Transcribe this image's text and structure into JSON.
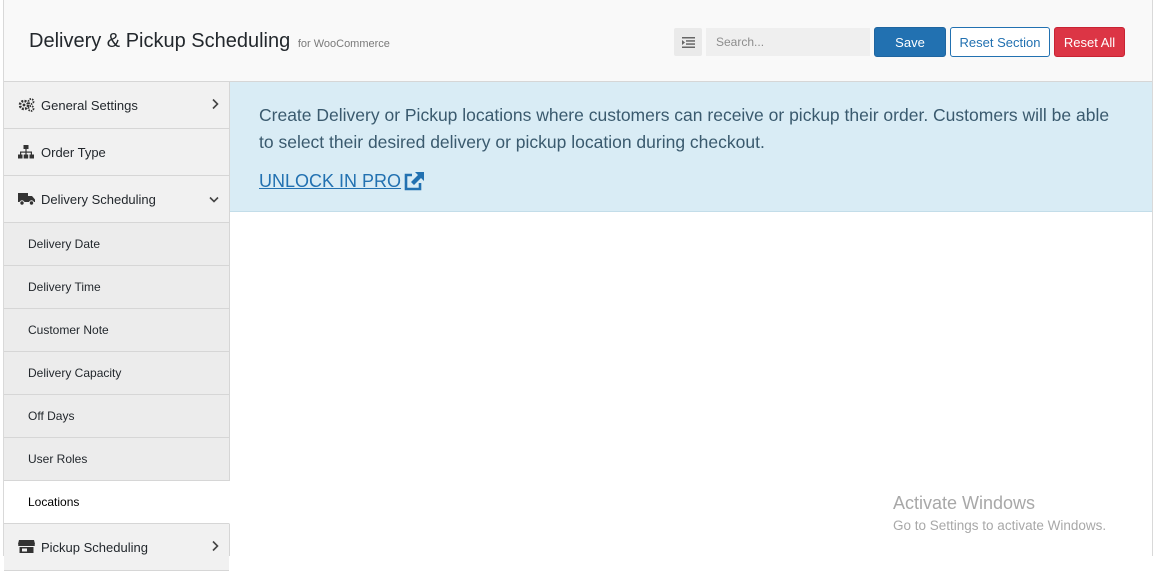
{
  "header": {
    "title": "Delivery & Pickup Scheduling",
    "subtitle": "for WooCommerce",
    "search_placeholder": "Search...",
    "save_label": "Save",
    "reset_section_label": "Reset Section",
    "reset_all_label": "Reset All"
  },
  "sidebar": {
    "items": [
      {
        "label": "General Settings",
        "icon": "cogs-icon"
      },
      {
        "label": "Order Type",
        "icon": "sitemap-icon"
      },
      {
        "label": "Delivery Scheduling",
        "icon": "truck-icon"
      }
    ],
    "sub_items": [
      {
        "label": "Delivery Date"
      },
      {
        "label": "Delivery Time"
      },
      {
        "label": "Customer Note"
      },
      {
        "label": "Delivery Capacity"
      },
      {
        "label": "Off Days"
      },
      {
        "label": "User Roles"
      },
      {
        "label": "Locations",
        "active": true
      }
    ],
    "after_items": [
      {
        "label": "Pickup Scheduling",
        "icon": "store-icon"
      }
    ]
  },
  "main": {
    "notice_text": "Create Delivery or Pickup locations where customers can receive or pickup their order. Customers will be able to select their desired delivery or pickup location during checkout.",
    "unlock_label": "UNLOCK IN PRO"
  },
  "watermark": {
    "title": "Activate Windows",
    "subtitle": "Go to Settings to activate Windows."
  },
  "colors": {
    "primary": "#2271b1",
    "danger": "#dc3545",
    "notice_bg": "#d9ecf5"
  }
}
